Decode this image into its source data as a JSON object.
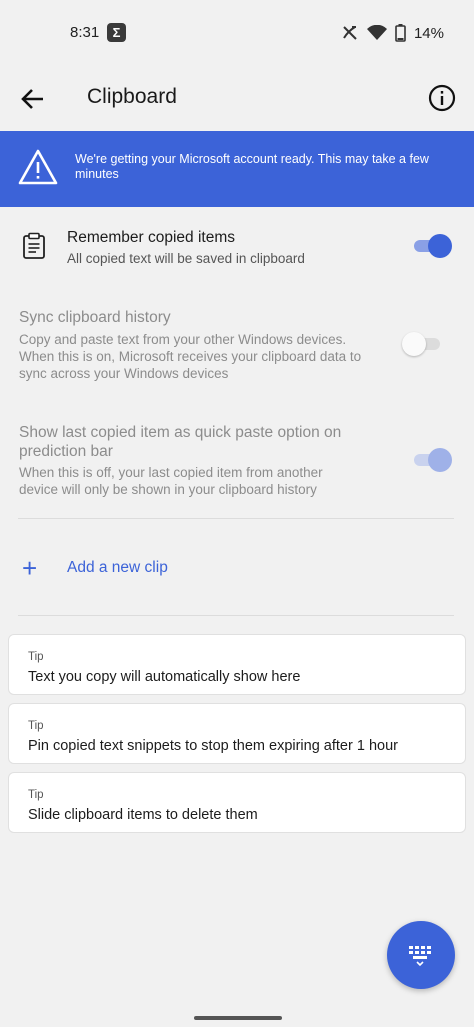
{
  "status_bar": {
    "time": "8:31",
    "battery": "14%"
  },
  "app_bar": {
    "title": "Clipboard"
  },
  "banner": {
    "text": "We're getting your Microsoft account ready. This may take a few minutes"
  },
  "settings": [
    {
      "title": "Remember copied items",
      "description": "All copied text will be saved in clipboard",
      "enabled": true,
      "on": true
    },
    {
      "title": "Sync clipboard history",
      "description": "Copy and paste text from your other Windows devices. When this is on, Microsoft receives your clipboard data to sync across your Windows devices",
      "enabled": false,
      "on": false
    },
    {
      "title": "Show last copied item as quick paste option on prediction bar",
      "description": "When this is off, your last copied item from another device will only be shown in your clipboard history",
      "enabled": false,
      "on": true
    }
  ],
  "add_clip": {
    "label": "Add a new clip"
  },
  "tips": [
    {
      "label": "Tip",
      "text": "Text you copy will automatically show here"
    },
    {
      "label": "Tip",
      "text": "Pin copied text snippets to stop them expiring after 1 hour"
    },
    {
      "label": "Tip",
      "text": "Slide clipboard items to delete them"
    }
  ],
  "colors": {
    "accent": "#3c63d8",
    "background": "#f1f1f1",
    "disabled_text": "#8c8c8c"
  }
}
